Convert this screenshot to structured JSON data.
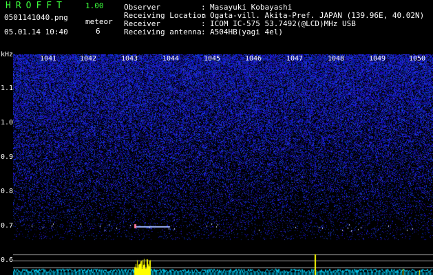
{
  "header": {
    "app_title": "HROFFT",
    "version": "1.00",
    "file_name": "0501141040.png",
    "date_time": "05.01.14 10:40",
    "meteor_label": "meteor",
    "meteor_count": "6"
  },
  "info": [
    {
      "label": "Observer",
      "value": "Masayuki Kobayashi"
    },
    {
      "label": "Receiving Location",
      "value": "Ogata-vill. Akita-Pref. JAPAN (139.96E, 40.02N)"
    },
    {
      "label": "Receiver",
      "value": "ICOM IC-575 53.7492(@LCD)MHz USB"
    },
    {
      "label": "Receiving antenna",
      "value": "A504HB(yagi 4el)"
    }
  ],
  "info_separator": ":",
  "axis": {
    "unit": "kHz",
    "freq_ticks": [
      "1041",
      "1042",
      "1043",
      "1044",
      "1045",
      "1046",
      "1047",
      "1048",
      "1049",
      "1050"
    ],
    "y_ticks": [
      "1.1",
      "1.0",
      "0.9",
      "0.8",
      "0.7",
      "0.6"
    ]
  },
  "colors": {
    "title_green": "#3cff3c",
    "background": "#000000",
    "noise_blue": "#2a3cff",
    "spectrum_cyan": "#00d8ff",
    "echo_yellow": "#ffff00",
    "gridline": "#9a9a9a"
  }
}
